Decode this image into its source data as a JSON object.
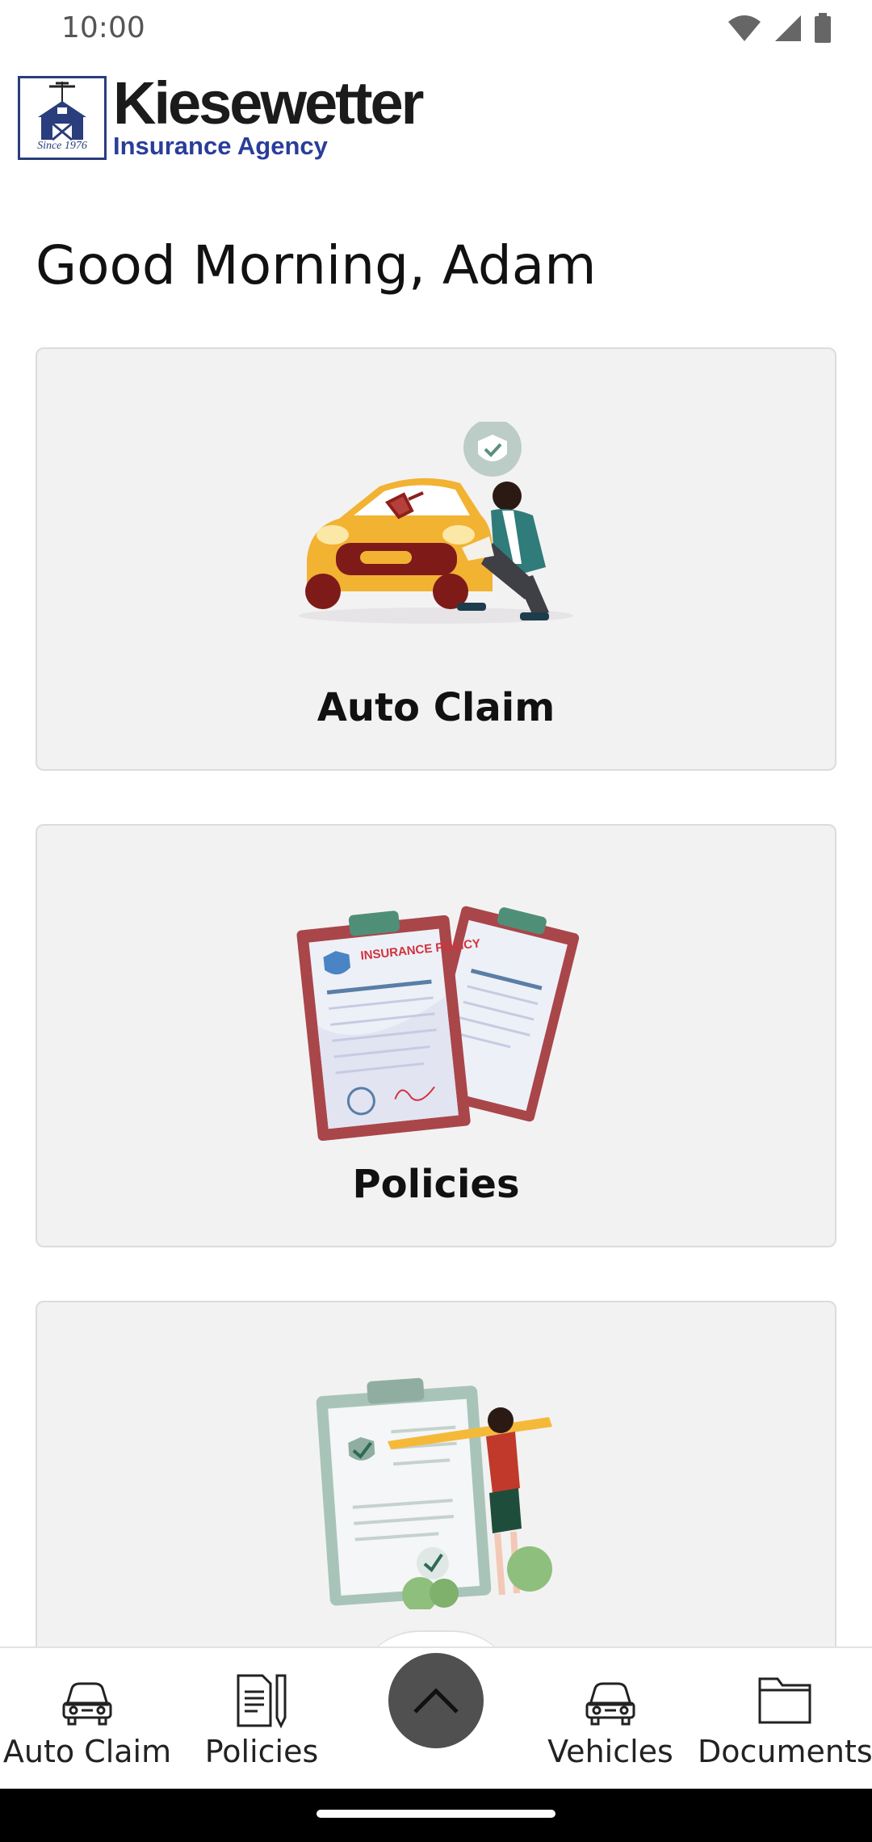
{
  "status_bar": {
    "time": "10:00"
  },
  "logo": {
    "name": "Kiesewetter",
    "subtitle": "Insurance Agency",
    "since": "Since 1976"
  },
  "greeting": "Good Morning, Adam",
  "cards": [
    {
      "label": "Auto Claim",
      "illustration": "auto-claim-illustration"
    },
    {
      "label": "Policies",
      "illustration": "insurance-policy-illustration",
      "art_text_1": "INSURANCE POLICY"
    },
    {
      "label": "",
      "illustration": "checklist-illustration"
    }
  ],
  "bottom_nav": {
    "items": [
      {
        "label": "Auto Claim",
        "icon": "car-icon"
      },
      {
        "label": "Policies",
        "icon": "document-pen-icon"
      },
      {
        "label": "Vehicles",
        "icon": "car-icon"
      },
      {
        "label": "Documents",
        "icon": "folder-icon"
      }
    ],
    "fab_icon": "chevron-up-icon"
  },
  "colors": {
    "card_bg": "#f3f2f3",
    "fab_bg": "#505050",
    "brand_blue": "#2a3d9a"
  }
}
